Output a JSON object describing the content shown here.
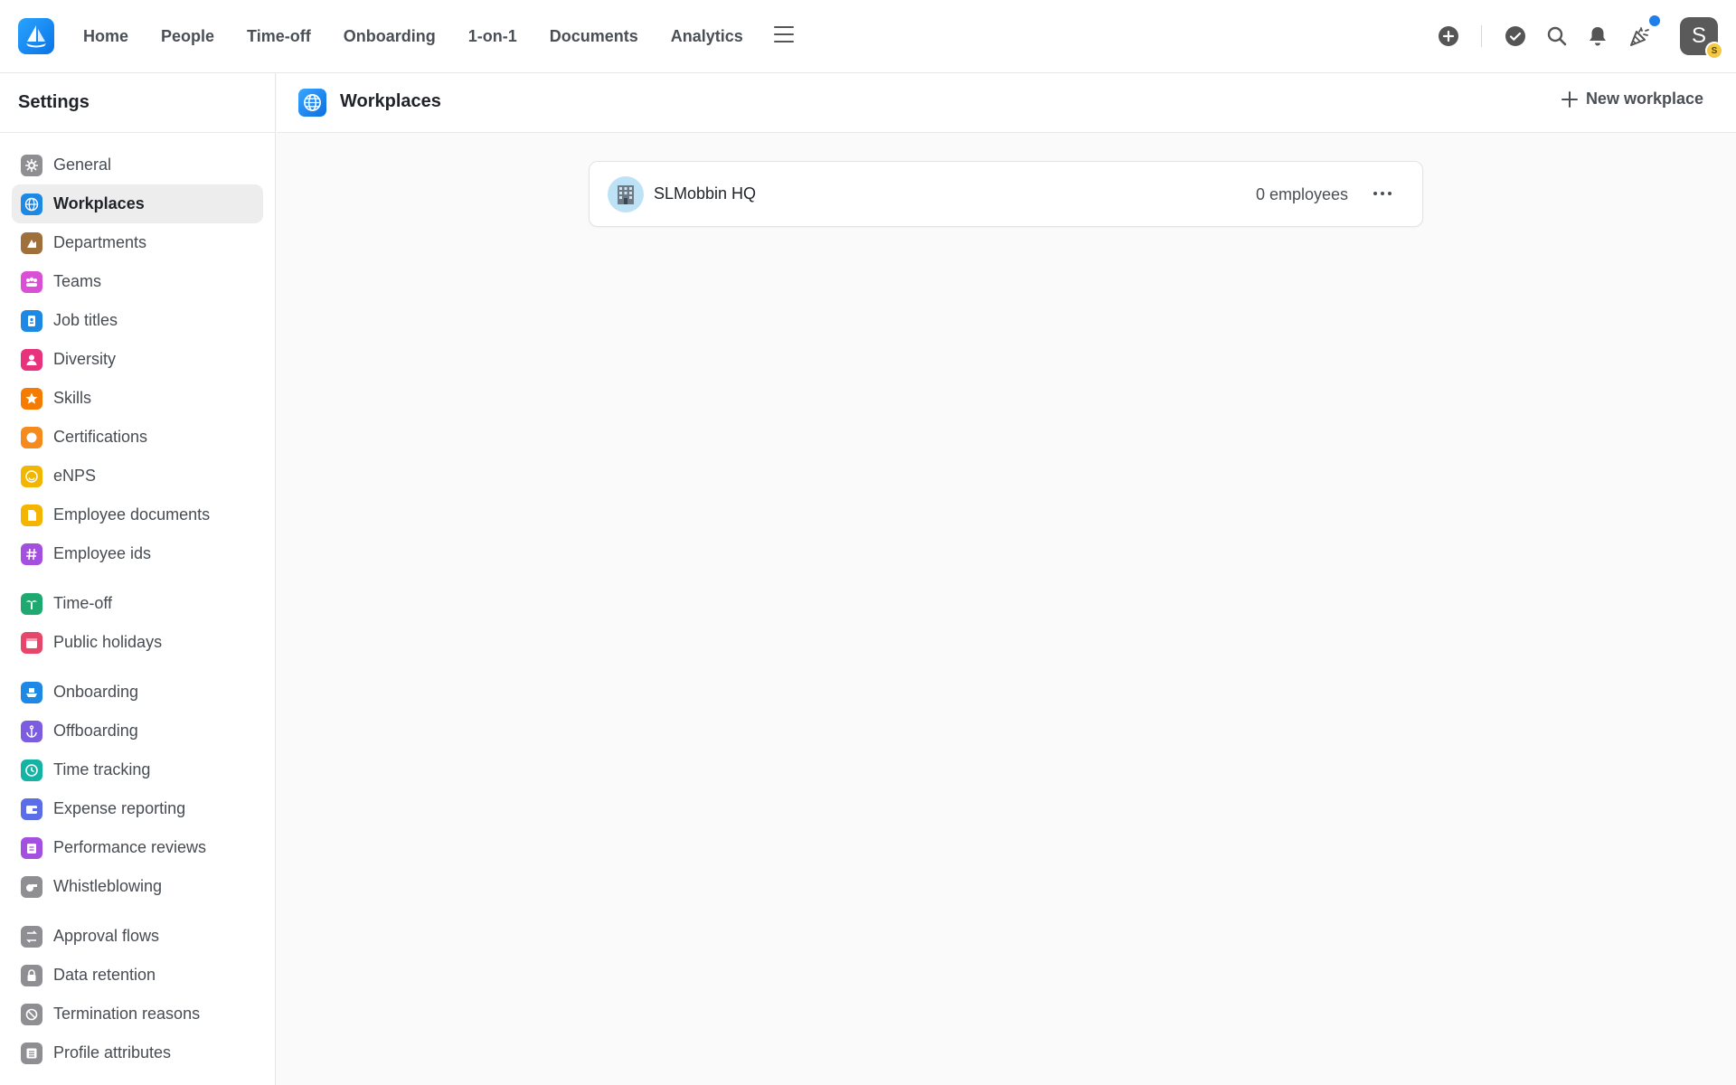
{
  "topbar": {
    "nav": [
      "Home",
      "People",
      "Time-off",
      "Onboarding",
      "1-on-1",
      "Documents",
      "Analytics"
    ],
    "avatar_initial": "S",
    "avatar_badge": "S",
    "notification_dot_color": "#1e7fe8"
  },
  "sidebar": {
    "title": "Settings",
    "groups": [
      [
        {
          "label": "General",
          "icon": "gear-icon",
          "color": "#8e8e93"
        },
        {
          "label": "Workplaces",
          "icon": "globe-icon",
          "color": "#1e88e5",
          "active": true
        },
        {
          "label": "Departments",
          "icon": "departments-icon",
          "color": "#a0703c"
        },
        {
          "label": "Teams",
          "icon": "teams-icon",
          "color": "#d94fd6"
        },
        {
          "label": "Job titles",
          "icon": "badge-icon",
          "color": "#1e88e5"
        },
        {
          "label": "Diversity",
          "icon": "person-icon",
          "color": "#e8327c"
        },
        {
          "label": "Skills",
          "icon": "star-icon",
          "color": "#f57c00"
        },
        {
          "label": "Certifications",
          "icon": "seal-icon",
          "color": "#f58a1f"
        },
        {
          "label": "eNPS",
          "icon": "smile-icon",
          "color": "#f2b600"
        },
        {
          "label": "Employee documents",
          "icon": "document-icon",
          "color": "#f5b400"
        },
        {
          "label": "Employee ids",
          "icon": "hash-icon",
          "color": "#a34fe0"
        }
      ],
      [
        {
          "label": "Time-off",
          "icon": "palm-tree-icon",
          "color": "#1fa971"
        },
        {
          "label": "Public holidays",
          "icon": "calendar-icon",
          "color": "#e8456a"
        }
      ],
      [
        {
          "label": "Onboarding",
          "icon": "ship-icon",
          "color": "#1e88e5"
        },
        {
          "label": "Offboarding",
          "icon": "anchor-icon",
          "color": "#7c5ce0"
        },
        {
          "label": "Time tracking",
          "icon": "clock-icon",
          "color": "#14b3a3"
        },
        {
          "label": "Expense reporting",
          "icon": "wallet-icon",
          "color": "#5b6ee8"
        },
        {
          "label": "Performance reviews",
          "icon": "clipboard-icon",
          "color": "#a34fe0"
        },
        {
          "label": "Whistleblowing",
          "icon": "whistle-icon",
          "color": "#8e8e93"
        }
      ],
      [
        {
          "label": "Approval flows",
          "icon": "flow-icon",
          "color": "#8e8e93"
        },
        {
          "label": "Data retention",
          "icon": "lock-icon",
          "color": "#8e8e93"
        },
        {
          "label": "Termination reasons",
          "icon": "prohibited-icon",
          "color": "#8e8e93"
        },
        {
          "label": "Profile attributes",
          "icon": "list-icon",
          "color": "#8e8e93"
        }
      ]
    ]
  },
  "main": {
    "title": "Workplaces",
    "new_button_label": "New workplace",
    "workplaces": [
      {
        "name": "SLMobbin HQ",
        "employees": "0 employees"
      }
    ]
  }
}
